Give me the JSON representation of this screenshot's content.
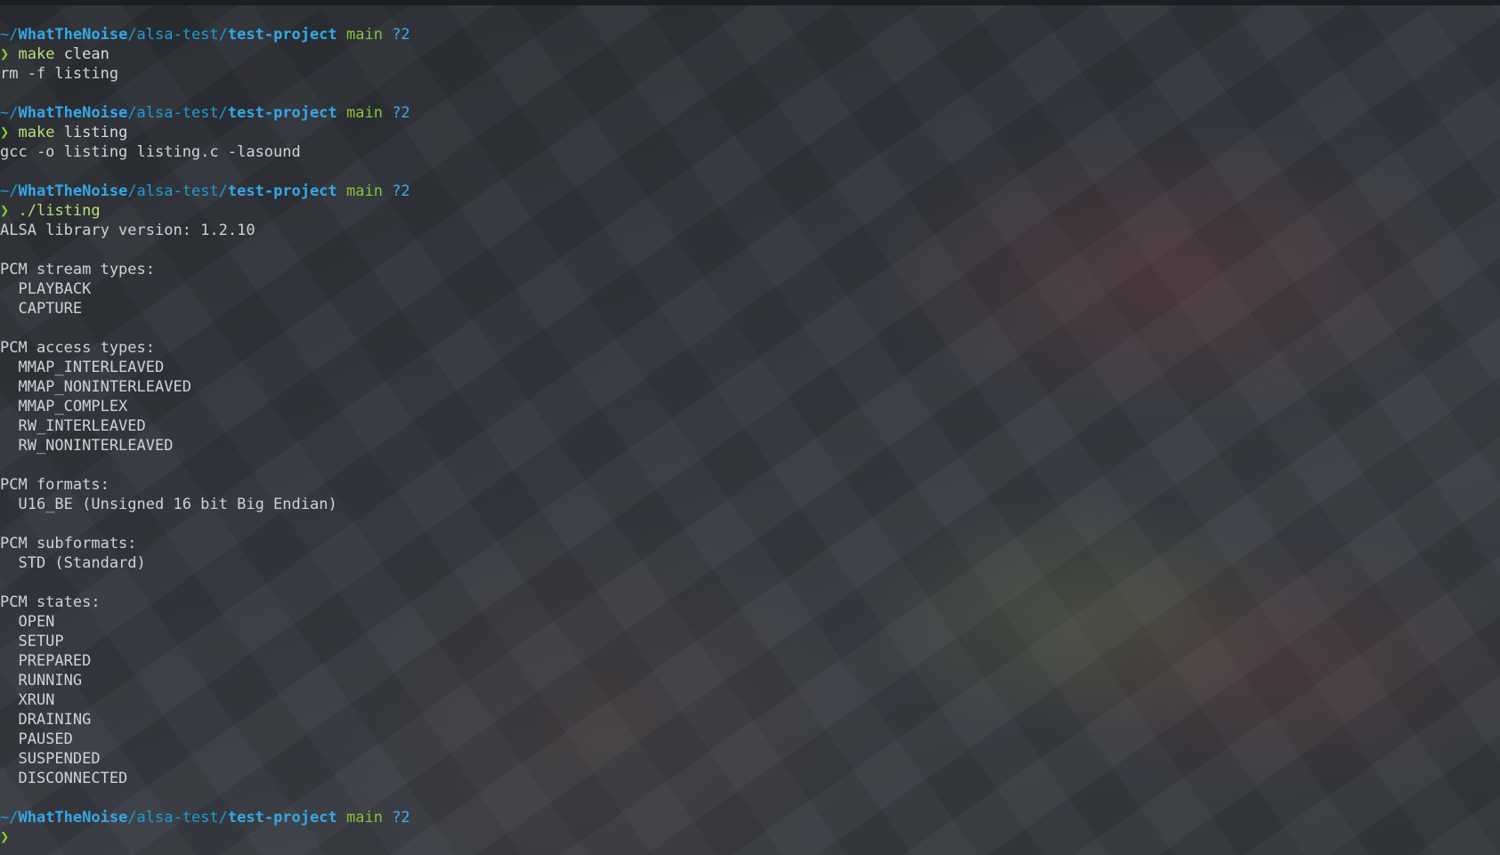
{
  "prompt": {
    "tilde": "~/",
    "user_dir": "WhatTheNoise",
    "mid_dir": "/alsa-test/",
    "project_dir": "test-project",
    "branch": "main",
    "status": "?2",
    "arrow": "❯"
  },
  "commands": [
    {
      "cmd": "make",
      "arg": " clean",
      "output": [
        "rm -f listing"
      ]
    },
    {
      "cmd": "make",
      "arg": " listing",
      "output": [
        "gcc -o listing listing.c -lasound"
      ]
    },
    {
      "cmd": "./listing",
      "arg": "",
      "output": [
        "ALSA library version: 1.2.10",
        "",
        "PCM stream types:",
        "  PLAYBACK",
        "  CAPTURE",
        "",
        "PCM access types:",
        "  MMAP_INTERLEAVED",
        "  MMAP_NONINTERLEAVED",
        "  MMAP_COMPLEX",
        "  RW_INTERLEAVED",
        "  RW_NONINTERLEAVED",
        "",
        "PCM formats:",
        "  U16_BE (Unsigned 16 bit Big Endian)",
        "",
        "PCM subformats:",
        "  STD (Standard)",
        "",
        "PCM states:",
        "  OPEN",
        "  SETUP",
        "  PREPARED",
        "  RUNNING",
        "  XRUN",
        "  DRAINING",
        "  PAUSED",
        "  SUSPENDED",
        "  DISCONNECTED"
      ]
    }
  ],
  "colors": {
    "path": "#1e9bd7",
    "branch": "#86c33b",
    "status": "#3fa9f0",
    "arrow": "#7ed320",
    "text": "#cfd3d8"
  }
}
